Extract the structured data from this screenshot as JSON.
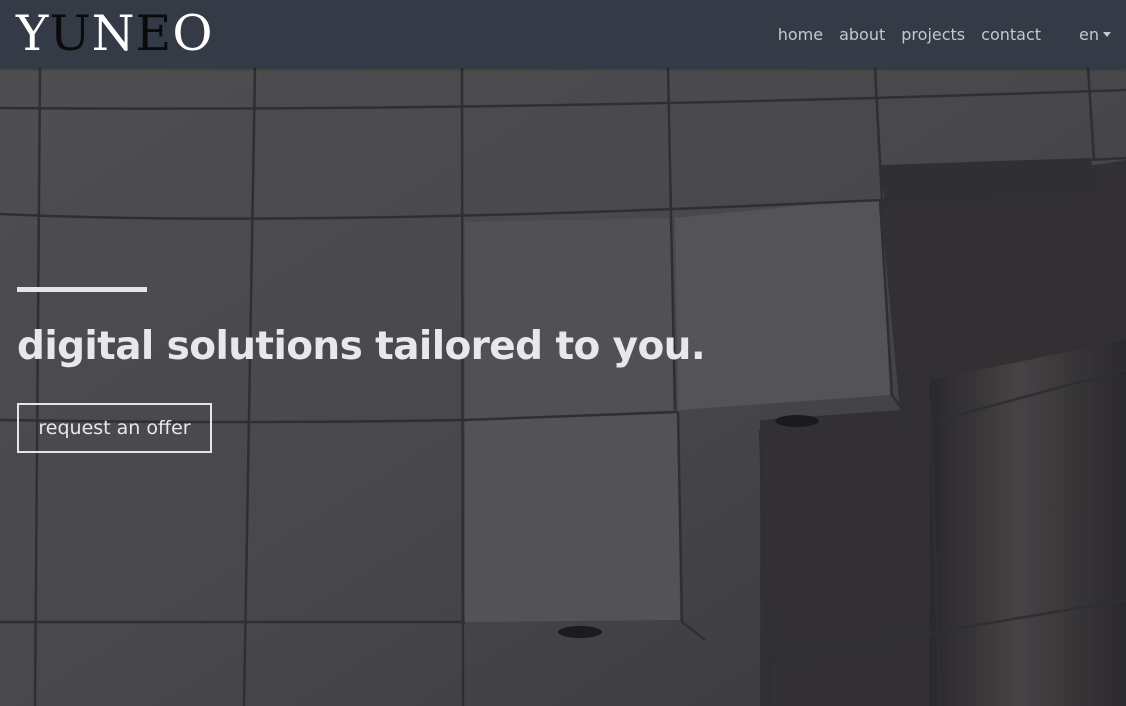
{
  "brand": {
    "logo_text": "YUNEO"
  },
  "nav": {
    "items": [
      {
        "label": "home"
      },
      {
        "label": "about"
      },
      {
        "label": "projects"
      },
      {
        "label": "contact"
      }
    ],
    "language": {
      "selected": "en",
      "icon": "caret-down-icon"
    }
  },
  "hero": {
    "headline": "digital solutions tailored to you.",
    "cta_label": "request an offer",
    "background": "tiled-wall-photo"
  },
  "colors": {
    "navbar_bg": "#343a46",
    "nav_text": "#c6c8cc",
    "hero_text": "#e8e8ec"
  }
}
